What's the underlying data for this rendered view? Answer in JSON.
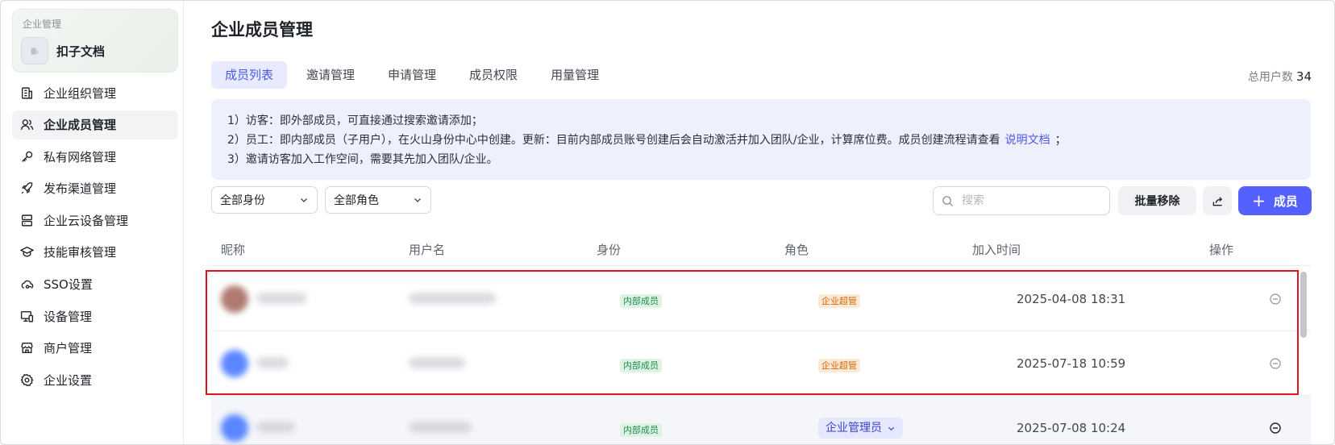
{
  "sidebar": {
    "org_kicker": "企业管理",
    "org_name": "扣子文档",
    "items": [
      {
        "label": "企业组织管理",
        "icon": "building-icon"
      },
      {
        "label": "企业成员管理",
        "icon": "users-icon"
      },
      {
        "label": "私有网络管理",
        "icon": "key-icon"
      },
      {
        "label": "发布渠道管理",
        "icon": "rocket-icon"
      },
      {
        "label": "企业云设备管理",
        "icon": "server-icon"
      },
      {
        "label": "技能审核管理",
        "icon": "graduation-cap-icon"
      },
      {
        "label": "SSO设置",
        "icon": "cloud-key-icon"
      },
      {
        "label": "设备管理",
        "icon": "devices-icon"
      },
      {
        "label": "商户管理",
        "icon": "store-icon"
      },
      {
        "label": "企业设置",
        "icon": "gear-icon"
      }
    ],
    "active_index": 1
  },
  "main": {
    "title": "企业成员管理",
    "tabs": [
      "成员列表",
      "邀请管理",
      "申请管理",
      "成员权限",
      "用量管理"
    ],
    "active_tab": 0,
    "total_label": "总用户数",
    "total_value": "34",
    "notice": {
      "line1": "1）访客：即外部成员，可直接通过搜索邀请添加；",
      "line2_pre": "2）员工：即内部成员（子用户），在火山身份中心中创建。更新：目前内部成员账号创建后会自动激活并加入团队/企业，计算席位费。成员创建流程请查看",
      "line2_link": "说明文档",
      "line2_post": "；",
      "line3": "3）邀请访客加入工作空间，需要其先加入团队/企业。"
    },
    "filters": {
      "identity": "全部身份",
      "role": "全部角色"
    },
    "search_placeholder": "搜索",
    "bulk_remove": "批量移除",
    "add_member": "成员",
    "columns": [
      "昵称",
      "用户名",
      "身份",
      "角色",
      "加入时间",
      "操作"
    ],
    "rows": [
      {
        "identity": "内部成员",
        "role": "企业超管",
        "joined": "2025-04-08 18:31",
        "avatar_color": "#b07a70"
      },
      {
        "identity": "内部成员",
        "role": "企业超管",
        "joined": "2025-07-18 10:59",
        "avatar_color": "#5b86ff"
      },
      {
        "identity": "内部成员",
        "role": "企业管理员",
        "joined": "2025-07-08 10:24",
        "avatar_color": "#5b86ff"
      }
    ]
  },
  "colors": {
    "accent": "#5561ff",
    "highlight": "#e0141e"
  }
}
